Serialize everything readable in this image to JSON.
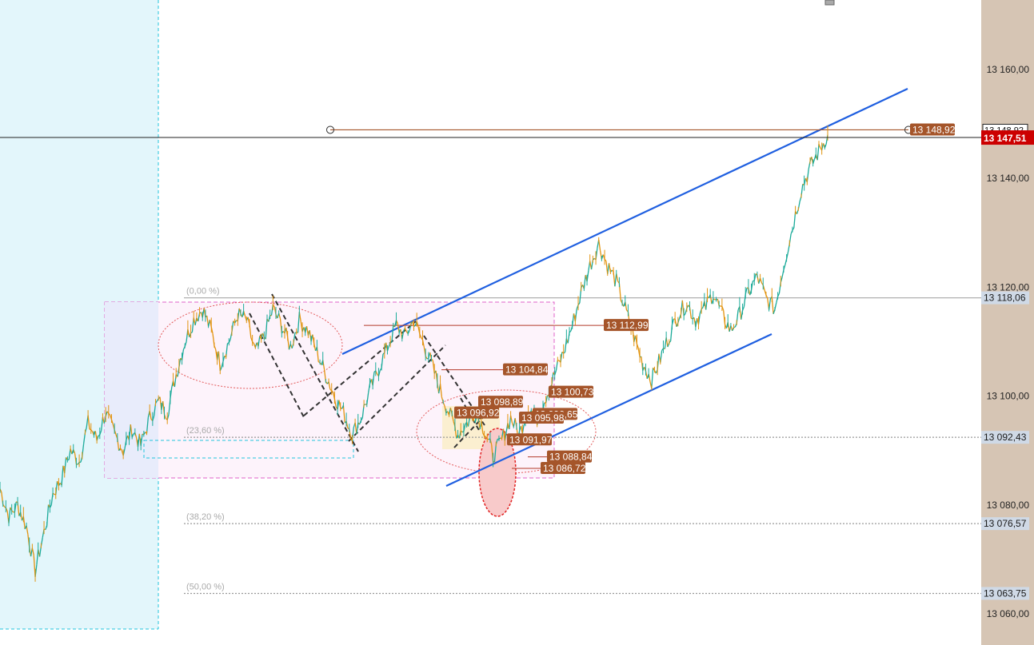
{
  "chart_data": {
    "type": "line",
    "title": "",
    "xlabel": "",
    "ylabel": "",
    "ylim": [
      13055,
      13185
    ],
    "y_ticks": [
      "13 160,00",
      "13 140,00",
      "13 120,00",
      "13 100,00",
      "13 080,00",
      "13 060,00"
    ],
    "y_tick_values": [
      13160,
      13140,
      13120,
      13100,
      13080,
      13060
    ],
    "grid": false,
    "current_price": {
      "label": "13 147,51",
      "value": 13147.51,
      "color": "#cc0000"
    },
    "series": [
      {
        "values": [
          13083,
          13078,
          13080,
          13076,
          13068,
          13075,
          13082,
          13085,
          13090,
          13088,
          13095,
          13092,
          13097,
          13093,
          13090,
          13094,
          13091,
          13096,
          13099,
          13097,
          13104,
          13110,
          13114,
          13116,
          13112,
          13106,
          13110,
          13115,
          13114,
          13108,
          13111,
          13116,
          13113,
          13109,
          13114,
          13112,
          13108,
          13104,
          13100,
          13097,
          13093,
          13096,
          13101,
          13105,
          13109,
          13113,
          13111,
          13114,
          13110,
          13106,
          13101,
          13097,
          13093,
          13095,
          13097,
          13094,
          13089,
          13092,
          13096,
          13093,
          13098,
          13096,
          13100,
          13104,
          13108,
          13113,
          13119,
          13124,
          13128,
          13124,
          13121,
          13116,
          13111,
          13106,
          13103,
          13107,
          13111,
          13115,
          13117,
          13114,
          13116,
          13119,
          13115,
          13112,
          13115,
          13119,
          13122,
          13118,
          13116,
          13124,
          13131,
          13138,
          13142,
          13145,
          13148
        ],
        "color": "#1aaa99"
      }
    ],
    "price_labels": [
      {
        "label": "13 148,92",
        "value": 13148.92
      },
      {
        "label": "13 112,99",
        "value": 13112.99
      },
      {
        "label": "13 104,84",
        "value": 13104.84
      },
      {
        "label": "13 100,73",
        "value": 13100.73
      },
      {
        "label": "13 098,89",
        "value": 13098.89
      },
      {
        "label": "13 096,92",
        "value": 13096.92
      },
      {
        "label": "13 096,65",
        "value": 13096.65
      },
      {
        "label": "13 095,98",
        "value": 13095.98
      },
      {
        "label": "13 091,97",
        "value": 13091.97
      },
      {
        "label": "13 088,84",
        "value": 13088.84
      },
      {
        "label": "13 086,72",
        "value": 13086.72
      }
    ],
    "fib_levels": [
      {
        "pct": "(0,00 %)",
        "label": "13 118,06",
        "value": 13118.06
      },
      {
        "pct": "(23,60 %)",
        "label": "13 092,43",
        "value": 13092.43
      },
      {
        "pct": "(38,20 %)",
        "label": "13 076,57",
        "value": 13076.57
      },
      {
        "pct": "(50,00 %)",
        "label": "13 063,75",
        "value": 13063.75
      }
    ],
    "axis_marker": {
      "label": "13 148,92",
      "value": 13148.92
    }
  }
}
